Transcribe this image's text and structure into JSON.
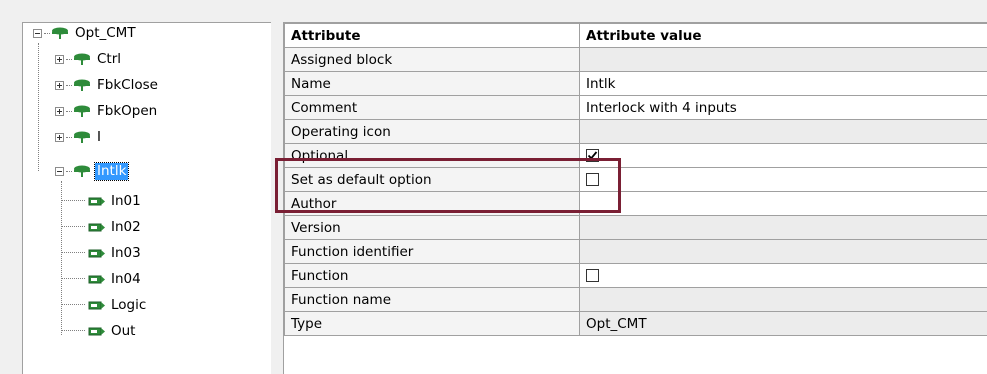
{
  "tree": {
    "root": {
      "label": "Opt_CMT",
      "expanded": true
    },
    "children": [
      {
        "label": "Ctrl",
        "expanded": false
      },
      {
        "label": "FbkClose",
        "expanded": false
      },
      {
        "label": "FbkOpen",
        "expanded": false
      },
      {
        "label": "I",
        "expanded": false
      },
      {
        "label": "Intlk",
        "expanded": true,
        "selected": true
      }
    ],
    "leaves": [
      "In01",
      "In02",
      "In03",
      "In04",
      "Logic",
      "Out"
    ]
  },
  "table": {
    "headers": [
      "Attribute",
      "Attribute value"
    ],
    "rows": [
      {
        "attribute": "Assigned block",
        "value": ""
      },
      {
        "attribute": "Name",
        "value": "Intlk"
      },
      {
        "attribute": "Comment",
        "value": "Interlock with 4 inputs"
      },
      {
        "attribute": "Operating icon",
        "value": ""
      },
      {
        "attribute": "Optional",
        "value": "",
        "checkbox": true,
        "checked": true
      },
      {
        "attribute": "Set as default option",
        "value": "",
        "checkbox": true,
        "checked": false
      },
      {
        "attribute": "Author",
        "value": ""
      },
      {
        "attribute": "Version",
        "value": ""
      },
      {
        "attribute": "Function identifier",
        "value": ""
      },
      {
        "attribute": "Function",
        "value": "",
        "checkbox": true,
        "checked": false
      },
      {
        "attribute": "Function name",
        "value": ""
      },
      {
        "attribute": "Type",
        "value": "Opt_CMT"
      }
    ]
  },
  "colors": {
    "highlight": "#7a1f34",
    "selection": "#3399ff",
    "node_icon": "#2e8b3a"
  },
  "icons": {
    "structure": "structure-node-icon",
    "input": "input-connector-icon"
  }
}
